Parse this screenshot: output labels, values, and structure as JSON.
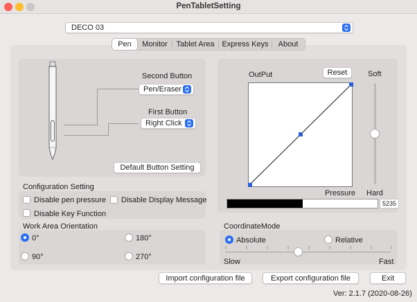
{
  "window": {
    "title": "PenTabletSetting"
  },
  "device": {
    "selected": "DECO 03"
  },
  "tabs": [
    "Pen",
    "Monitor",
    "Tablet Area",
    "Express Keys",
    "About"
  ],
  "pen": {
    "second_button_label": "Second Button",
    "second_button_value": "Pen/Eraser",
    "first_button_label": "First Button",
    "first_button_value": "Right Click",
    "default_button": "Default  Button Setting"
  },
  "pressure": {
    "output_label": "OutPut",
    "reset_button": "Reset",
    "soft_label": "Soft",
    "hard_label": "Hard",
    "x_label": "Pressure",
    "value": "5235",
    "level_fraction": 0.5,
    "sensitivity_fraction": 0.5
  },
  "config": {
    "title": "Configuration Setting",
    "disable_pressure": "Disable pen pressure",
    "disable_display_message": "Disable Display Message",
    "disable_key_function": "Disable Key Function"
  },
  "orientation": {
    "title": "Work Area Orientation",
    "options": [
      "0°",
      "180°",
      "90°",
      "270°"
    ],
    "selected": "0°"
  },
  "coordinate": {
    "title": "CoordinateMode",
    "absolute": "Absolute",
    "relative": "Relative",
    "selected": "Absolute",
    "slow": "Slow",
    "fast": "Fast",
    "speed_fraction": 0.5
  },
  "buttons": {
    "import": "Import configuration file",
    "export": "Export configuration file",
    "exit": "Exit"
  },
  "version": "Ver: 2.1.7 (2020-08-26)",
  "colors": {
    "accent": "#2a6ef2",
    "close": "#fe5f57",
    "minimize": "#febc2e",
    "zoom": "#c9c6c5"
  }
}
